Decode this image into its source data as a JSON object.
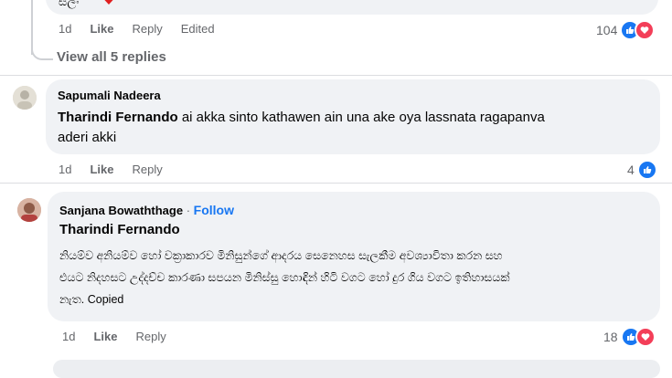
{
  "top_comment": {
    "text_tail": "ස්ලං",
    "actions": {
      "time": "1d",
      "like": "Like",
      "reply": "Reply",
      "edited": "Edited"
    },
    "reaction_count": "104"
  },
  "view_replies": "View all 5 replies",
  "comment2": {
    "author": "Sapumali Nadeera",
    "mention": "Tharindi Fernando",
    "text_line1": "ai akka sinto kathawen ain una ake oya lassnata ragapanva",
    "text_line2": "aderi akki",
    "actions": {
      "time": "1d",
      "like": "Like",
      "reply": "Reply"
    },
    "reaction_count": "4"
  },
  "comment3": {
    "author": "Sanjana Bowaththage",
    "separator": "·",
    "follow": "Follow",
    "mention": "Tharindi Fernando",
    "text_line1": "නියම්ව අනියම්ව හෝ වක්‍රාකාරව මිනිසුන්ගේ ආදරය සෙනෙහස සැලකීම අවශ්‍යාවිතා කරන සහ",
    "text_line2": "එයට නිදහසට උද්දච්ච කාරණා සපයන මිනිස්සු හොඳින් හිටි වගට හෝ දුර ගිය වගට ඉතිහාසයක්",
    "text_line3": "නැත. Copied",
    "actions": {
      "time": "1d",
      "like": "Like",
      "reply": "Reply"
    },
    "reaction_count": "18"
  },
  "colors": {
    "bubble": "#f0f2f5",
    "like": "#1877f2",
    "love": "#f33e58",
    "follow": "#1877f2"
  }
}
